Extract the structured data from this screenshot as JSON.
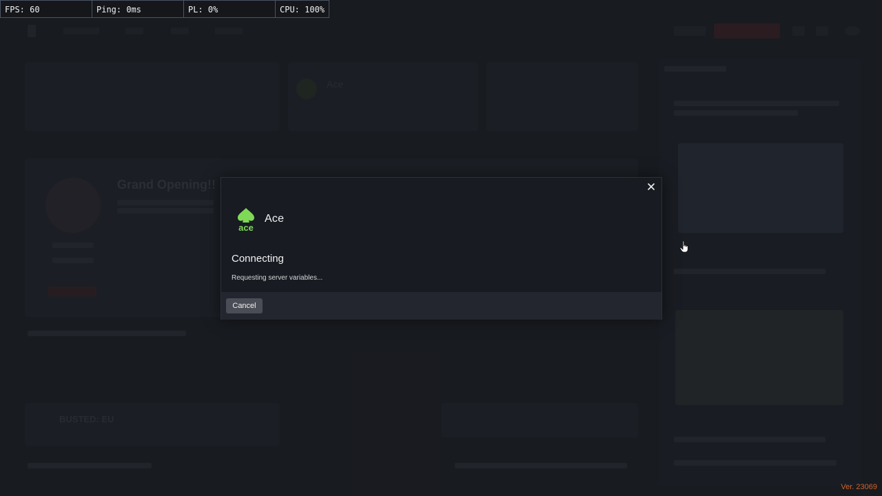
{
  "stats": [
    {
      "label": "FPS: 60"
    },
    {
      "label": "Ping: 0ms"
    },
    {
      "label": "PL: 0%"
    },
    {
      "label": "CPU: 100%"
    }
  ],
  "background": {
    "server_card_name": "Ace",
    "featured_title": "Grand Opening!!",
    "card_text": "BUSTED: EU"
  },
  "modal": {
    "server_name": "Ace",
    "logo_text": "ace",
    "status_title": "Connecting",
    "status_detail": "Requesting server variables...",
    "cancel_label": "Cancel",
    "accent_color": "#7ed957"
  },
  "icons": {
    "close": "close-icon",
    "logo": "ace-spade-logo",
    "cursor": "hand-pointer-cursor"
  },
  "version": "Ver. 23069"
}
